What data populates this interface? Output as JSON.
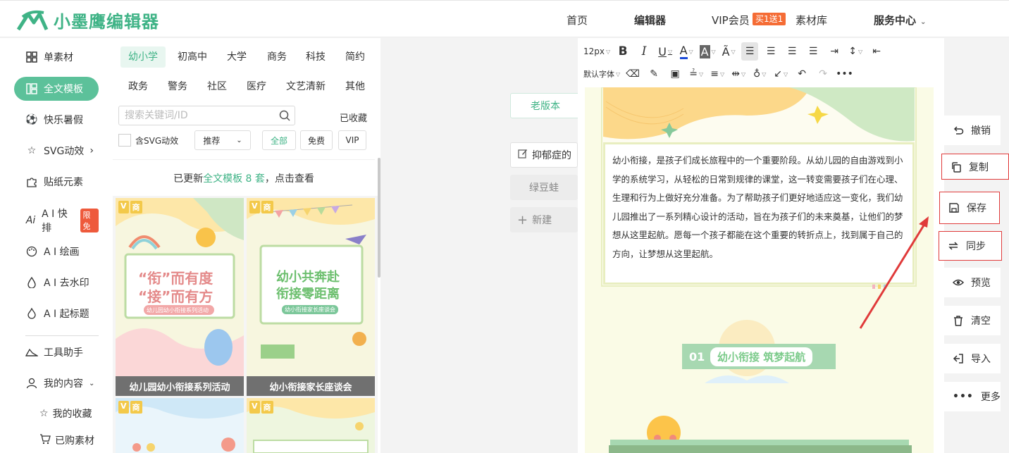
{
  "header": {
    "logo_text": "小墨鹰编辑器",
    "nav": [
      "首页",
      "编辑器",
      "VIP会员",
      "素材库",
      "服务中心"
    ],
    "vip_badge": "买1送1"
  },
  "sidebar": {
    "items": [
      "单素材",
      "全文模板",
      "快乐暑假",
      "SVG动效",
      "贴纸元素",
      "A I 快排",
      "A I 绘画",
      "A I 去水印",
      "A I 起标题",
      "工具助手",
      "我的内容"
    ],
    "ai_badge": "限免",
    "sub_items": [
      "我的收藏",
      "已购素材"
    ]
  },
  "panel": {
    "categories_row1": [
      "幼小学",
      "初高中",
      "大学",
      "商务",
      "科技",
      "简约"
    ],
    "categories_row2": [
      "政务",
      "警务",
      "社区",
      "医疗",
      "文艺清新",
      "其他"
    ],
    "search_placeholder": "搜索关键词/ID",
    "collected": "已收藏",
    "svg_check": "含SVG动效",
    "sort": "推荐",
    "filters": [
      "全部",
      "免费",
      "VIP"
    ],
    "update_prefix": "已更新",
    "update_highlight": "全文模板 8 套",
    "update_suffix": "，点击查看",
    "shang": "商",
    "cards": [
      {
        "title": "幼儿园幼小衔接系列活动",
        "line1": "“衔”而有度",
        "line2": "“接”而有方",
        "sub": "幼儿园幼小衔接系列活动"
      },
      {
        "title": "幼小衔接家长座谈会",
        "line1": "幼小共奔赴",
        "line2": "衔接零距离",
        "sub": "幼小衔接家长座谈会"
      }
    ]
  },
  "center": {
    "old_version": "老版本",
    "docs": [
      "抑郁症的",
      "绿豆蛙"
    ],
    "new_doc": "新建"
  },
  "editor": {
    "font_size": "12px",
    "font_family": "默认字体",
    "body_text": "幼小衔接，是孩子们成长旅程中的一个重要阶段。从幼儿园的自由游戏到小学的系统学习，从轻松的日常到规律的课堂，这一转变需要孩子们在心理、生理和行为上做好充分准备。为了帮助孩子们更好地适应这一变化，我们幼儿园推出了一系列精心设计的活动，旨在为孩子们的未来奠基，让他们的梦想从这里起航。愿每一个孩子都能在这个重要的转折点上，找到属于自己的方向，让梦想从这里起航。",
    "section_num": "01",
    "section_title": "幼小衔接 筑梦起航"
  },
  "actions": [
    "撤销",
    "复制",
    "保存",
    "同步",
    "预览",
    "清空",
    "导入",
    "更多"
  ],
  "colors": {
    "brand": "#3fb386",
    "highlight_box": "#e03a3a",
    "arrow": "#e03a3a"
  }
}
